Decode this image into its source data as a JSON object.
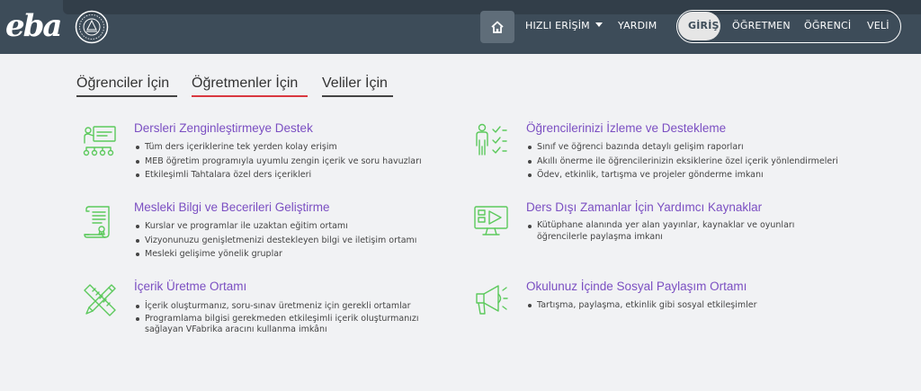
{
  "header": {
    "logo_text": "eba",
    "nav": {
      "home_icon": "home-icon",
      "quick_access": "HIZLI ERİŞİM",
      "help": "YARDIM"
    },
    "roles": {
      "login": "GİRİŞ",
      "teacher": "ÖĞRETMEN",
      "student": "ÖĞRENCİ",
      "parent": "VELİ"
    }
  },
  "tabs": [
    {
      "label": "Öğrenciler İçin",
      "active": false
    },
    {
      "label": "Öğretmenler İçin",
      "active": true
    },
    {
      "label": "Veliler İçin",
      "active": false
    }
  ],
  "colors": {
    "header_bg": "#3d4c59",
    "accent_title": "#7b4fc2",
    "icon_green": "#5cc95c",
    "active_tab_underline": "#d9383f"
  },
  "features": [
    {
      "icon": "presentation-icon",
      "title": "Dersleri Zenginleştirmeye Destek",
      "bullets": [
        "Tüm ders içeriklerine tek yerden kolay erişim",
        "MEB öğretim programıyla uyumlu zengin içerik ve soru havuzları",
        "Etkileşimli Tahtalara özel ders içerikleri"
      ]
    },
    {
      "icon": "student-checklist-icon",
      "title": "Öğrencilerinizi İzleme ve Destekleme",
      "bullets": [
        "Sınıf ve öğrenci bazında detaylı gelişim raporları",
        "Akıllı önerme ile öğrencilerinizin eksiklerine özel içerik yönlendirmeleri",
        "Ödev, etkinlik, tartışma ve projeler gönderme imkanı"
      ]
    },
    {
      "icon": "certificate-scroll-icon",
      "title": "Mesleki Bilgi ve Becerileri Geliştirme",
      "bullets": [
        "Kurslar ve programlar ile uzaktan eğitim ortamı",
        "Vizyonunuzu genişletmenizi destekleyen bilgi ve iletişim ortamı",
        "Mesleki gelişime yönelik gruplar"
      ]
    },
    {
      "icon": "video-screen-icon",
      "title": "Ders Dışı Zamanlar İçin Yardımcı Kaynaklar",
      "bullets": [
        "Kütüphane alanında yer alan yayınlar, kaynaklar ve oyunları öğrencilerle paylaşma imkanı"
      ]
    },
    {
      "icon": "pencil-ruler-icon",
      "title": "İçerik Üretme Ortamı",
      "bullets": [
        "İçerik oluşturmanız, soru-sınav üretmeniz için gerekli ortamlar",
        "Programlama bilgisi gerekmeden etkileşimli içerik oluşturmanızı sağlayan VFabrika aracını kullanma imkânı"
      ]
    },
    {
      "icon": "megaphone-icon",
      "title": "Okulunuz İçinde Sosyal Paylaşım Ortamı",
      "bullets": [
        "Tartışma, paylaşma, etkinlik gibi sosyal etkileşimler"
      ]
    }
  ]
}
